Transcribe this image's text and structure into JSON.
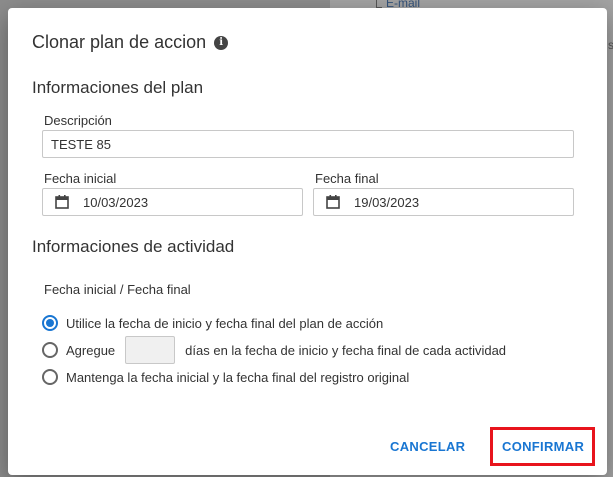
{
  "background": {
    "link_text": "E-mail",
    "fragment": "s"
  },
  "dialog": {
    "title": "Clonar plan de accion",
    "info_icon": "info-icon",
    "plan_section": {
      "title": "Informaciones del plan",
      "description_label": "Descripción",
      "description_value": "TESTE 85",
      "start_label": "Fecha inicial",
      "start_value": "10/03/2023",
      "end_label": "Fecha final",
      "end_value": "19/03/2023"
    },
    "activity_section": {
      "title": "Informaciones de actividad",
      "group_label": "Fecha inicial / Fecha final",
      "options": [
        {
          "label": "Utilice la fecha de inicio y fecha final del plan de acción",
          "checked": true
        },
        {
          "label_before": "Agregue",
          "days_value": "",
          "label_after": "días en la fecha de inicio y fecha final de cada actividad",
          "checked": false
        },
        {
          "label": "Mantenga la fecha inicial y la fecha final del registro original",
          "checked": false
        }
      ]
    },
    "actions": {
      "cancel_label": "CANCELAR",
      "confirm_label": "CONFIRMAR"
    },
    "colors": {
      "accent": "#1976d2",
      "highlight": "#e8141c"
    }
  }
}
